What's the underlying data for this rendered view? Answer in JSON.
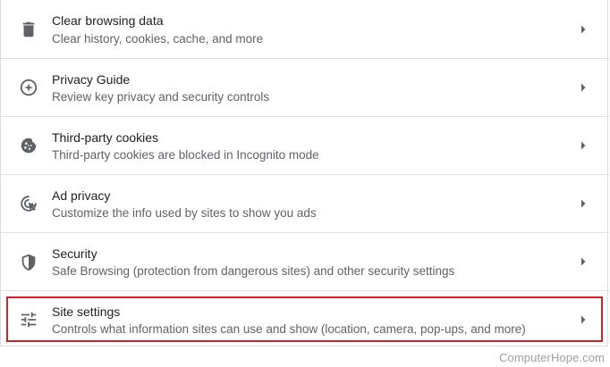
{
  "settings": {
    "items": [
      {
        "title": "Clear browsing data",
        "subtitle": "Clear history, cookies, cache, and more",
        "icon": "trash-icon"
      },
      {
        "title": "Privacy Guide",
        "subtitle": "Review key privacy and security controls",
        "icon": "compass-icon"
      },
      {
        "title": "Third-party cookies",
        "subtitle": "Third-party cookies are blocked in Incognito mode",
        "icon": "cookie-icon"
      },
      {
        "title": "Ad privacy",
        "subtitle": "Customize the info used by sites to show you ads",
        "icon": "ad-privacy-icon"
      },
      {
        "title": "Security",
        "subtitle": "Safe Browsing (protection from dangerous sites) and other security settings",
        "icon": "shield-icon"
      },
      {
        "title": "Site settings",
        "subtitle": "Controls what information sites can use and show (location, camera, pop-ups, and more)",
        "icon": "sliders-icon"
      }
    ]
  },
  "highlight": {
    "color": "#d0202a",
    "target": "Site settings"
  },
  "watermark": "ComputerHope.com",
  "colors": {
    "title": "#202124",
    "subtitle": "#5f6368",
    "icon": "#5f6368",
    "divider": "#e0e0e0"
  }
}
